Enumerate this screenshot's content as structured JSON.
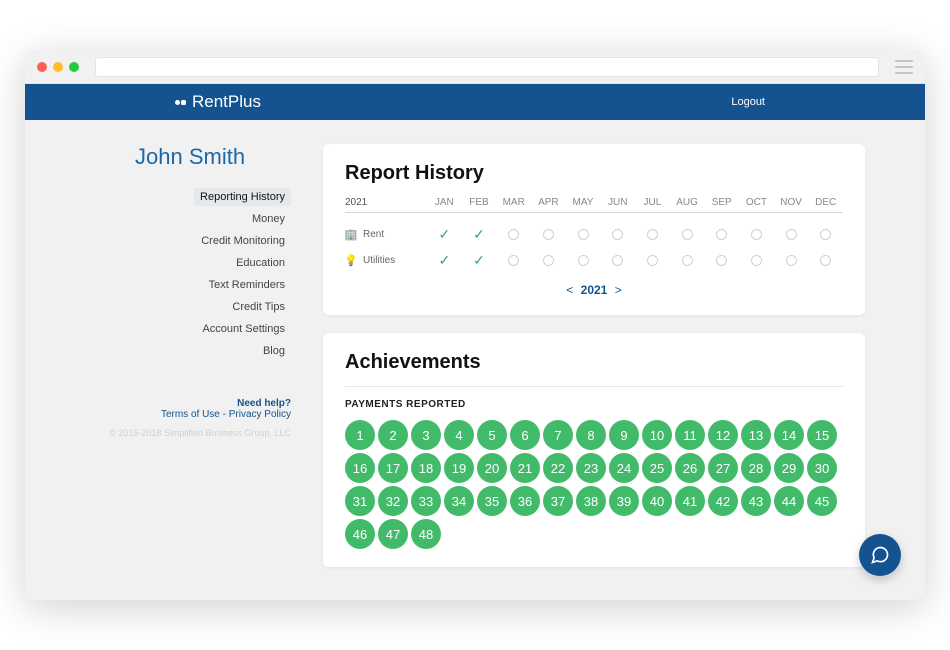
{
  "brand": "RentPlus",
  "header": {
    "logout": "Logout"
  },
  "user_name": "John Smith",
  "sidebar": {
    "items": [
      {
        "label": "Reporting History",
        "active": true
      },
      {
        "label": "Money",
        "active": false
      },
      {
        "label": "Credit Monitoring",
        "active": false
      },
      {
        "label": "Education",
        "active": false
      },
      {
        "label": "Text Reminders",
        "active": false
      },
      {
        "label": "Credit Tips",
        "active": false
      },
      {
        "label": "Account Settings",
        "active": false
      },
      {
        "label": "Blog",
        "active": false
      }
    ],
    "help": {
      "need": "Need help?",
      "terms": "Terms of Use",
      "sep": " - ",
      "privacy": "Privacy Policy"
    },
    "copyright": "© 2015-2018 Simplified Business Group, LLC"
  },
  "report": {
    "title": "Report History",
    "year": "2021",
    "months": [
      "JAN",
      "FEB",
      "MAR",
      "APR",
      "MAY",
      "JUN",
      "JUL",
      "AUG",
      "SEP",
      "OCT",
      "NOV",
      "DEC"
    ],
    "rows": [
      {
        "icon": "building-icon",
        "label": "Rent",
        "status": [
          "paid",
          "paid",
          "empty",
          "empty",
          "empty",
          "empty",
          "empty",
          "empty",
          "empty",
          "empty",
          "empty",
          "empty"
        ]
      },
      {
        "icon": "bulb-icon",
        "label": "Utilities",
        "status": [
          "paid",
          "paid",
          "empty",
          "empty",
          "empty",
          "empty",
          "empty",
          "empty",
          "empty",
          "empty",
          "empty",
          "empty"
        ]
      }
    ],
    "nav": {
      "prev": "<",
      "year": "2021",
      "next": ">"
    }
  },
  "achievements": {
    "title": "Achievements",
    "subtitle": "PAYMENTS REPORTED",
    "badges": [
      1,
      2,
      3,
      4,
      5,
      6,
      7,
      8,
      9,
      10,
      11,
      12,
      13,
      14,
      15,
      16,
      17,
      18,
      19,
      20,
      21,
      22,
      23,
      24,
      25,
      26,
      27,
      28,
      29,
      30,
      31,
      32,
      33,
      34,
      35,
      36,
      37,
      38,
      39,
      40,
      41,
      42,
      43,
      44,
      45,
      46,
      47,
      48
    ]
  },
  "colors": {
    "brand": "#14538f",
    "accent": "#41bb6a",
    "check": "#3aaa5f"
  }
}
